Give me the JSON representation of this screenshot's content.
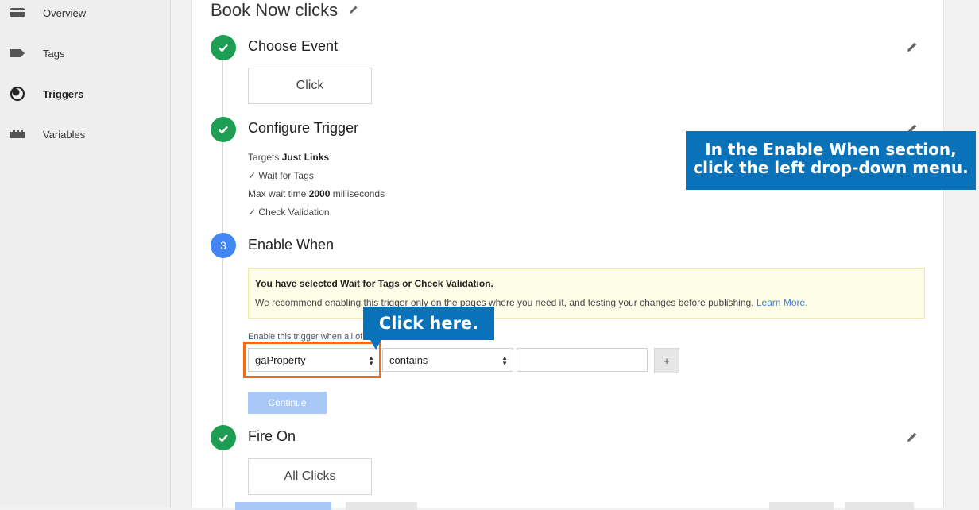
{
  "sidebar": {
    "items": [
      {
        "label": "Overview",
        "icon": "overview-icon"
      },
      {
        "label": "Tags",
        "icon": "tag-icon"
      },
      {
        "label": "Triggers",
        "icon": "trigger-icon",
        "active": true
      },
      {
        "label": "Variables",
        "icon": "variables-icon"
      }
    ]
  },
  "trigger": {
    "title": "Book Now clicks",
    "steps": {
      "choose_event": {
        "title": "Choose Event",
        "value": "Click",
        "status": "done"
      },
      "configure_trigger": {
        "title": "Configure Trigger",
        "status": "done",
        "targets_prefix": "Targets",
        "targets_value": "Just Links",
        "wait_for_tags": "Wait for Tags",
        "max_wait_prefix": "Max wait time",
        "max_wait_value": "2000",
        "max_wait_suffix": "milliseconds",
        "check_validation": "Check Validation"
      },
      "enable_when": {
        "number": "3",
        "title": "Enable When",
        "status": "current",
        "warning_title": "You have selected Wait for Tags or Check Validation.",
        "warning_text": "We recommend enabling this trigger only on the pages where you need it, and testing your changes before publishing.",
        "learn_more": "Learn More",
        "learn_more_suffix": ".",
        "condition_label": "Enable this trigger when all of these conditions are true:",
        "variable_select": "gaProperty",
        "operator_select": "contains",
        "value_input": "",
        "add_button": "+",
        "continue_button": "Continue"
      },
      "fire_on": {
        "title": "Fire On",
        "value": "All Clicks",
        "status": "done"
      }
    }
  },
  "callouts": {
    "instruction_line1": "In the Enable When section,",
    "instruction_line2": "click the left drop-down menu.",
    "click_here": "Click here."
  },
  "colors": {
    "done": "#1e9e54",
    "current": "#4285f4",
    "callout": "#0a72b8",
    "highlight": "#ef6c1c",
    "warning_bg": "#fefde8",
    "continue_bg": "#a8c8f8"
  }
}
